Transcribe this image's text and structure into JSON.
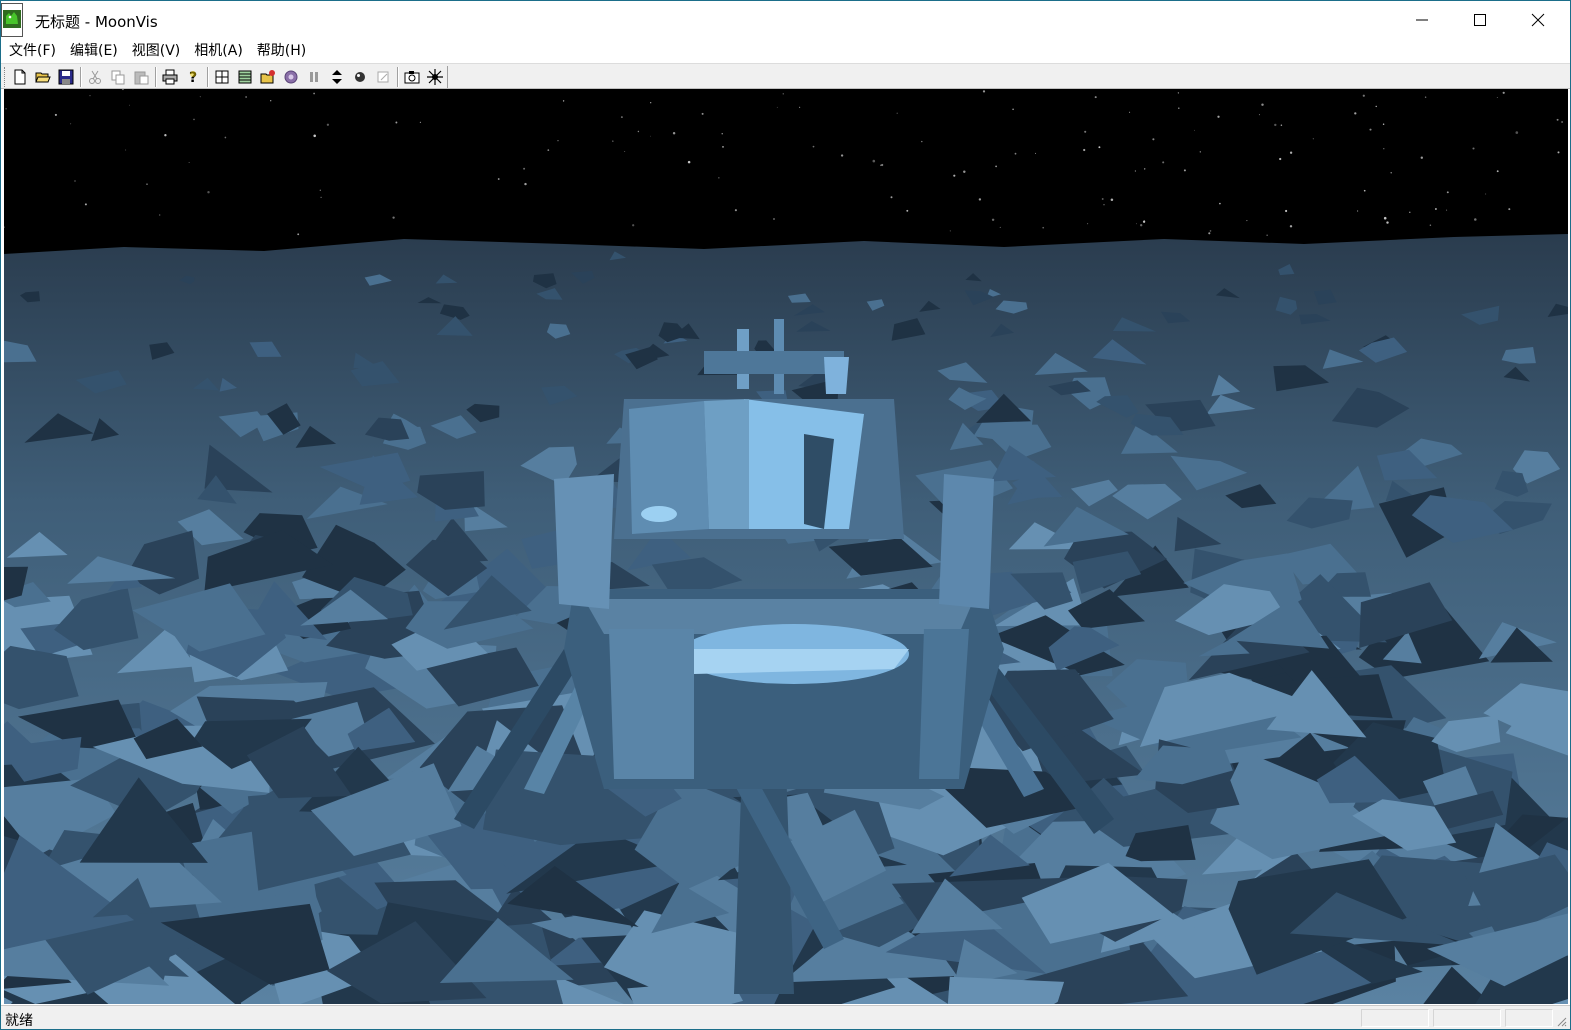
{
  "window": {
    "title": "无标题 - MoonVis"
  },
  "menu": {
    "items": [
      "文件(F)",
      "编辑(E)",
      "视图(V)",
      "相机(A)",
      "帮助(H)"
    ]
  },
  "toolbar": {
    "buttons": [
      {
        "icon": "new-file-icon"
      },
      {
        "icon": "open-folder-icon"
      },
      {
        "icon": "save-icon"
      },
      {
        "icon": "cut-icon"
      },
      {
        "icon": "copy-icon"
      },
      {
        "icon": "paste-icon"
      },
      {
        "icon": "print-icon"
      },
      {
        "icon": "help-icon"
      },
      {
        "icon": "grid-view-icon"
      },
      {
        "icon": "list-view-icon"
      },
      {
        "icon": "load-model-icon"
      },
      {
        "icon": "settings-gear-icon"
      },
      {
        "icon": "pause-icon"
      },
      {
        "icon": "refresh-icon"
      },
      {
        "icon": "sphere-icon"
      },
      {
        "icon": "edit-icon"
      },
      {
        "icon": "camera-icon"
      },
      {
        "icon": "sun-light-icon"
      }
    ]
  },
  "scene": {
    "description_colors": {
      "sky": "#000000",
      "terrain_dark": "#253a4f",
      "terrain_mid": "#4a6f8c",
      "terrain_light": "#6a93b3",
      "lander_highlight": "#8fc4ec"
    }
  },
  "status": {
    "text": "就绪"
  }
}
